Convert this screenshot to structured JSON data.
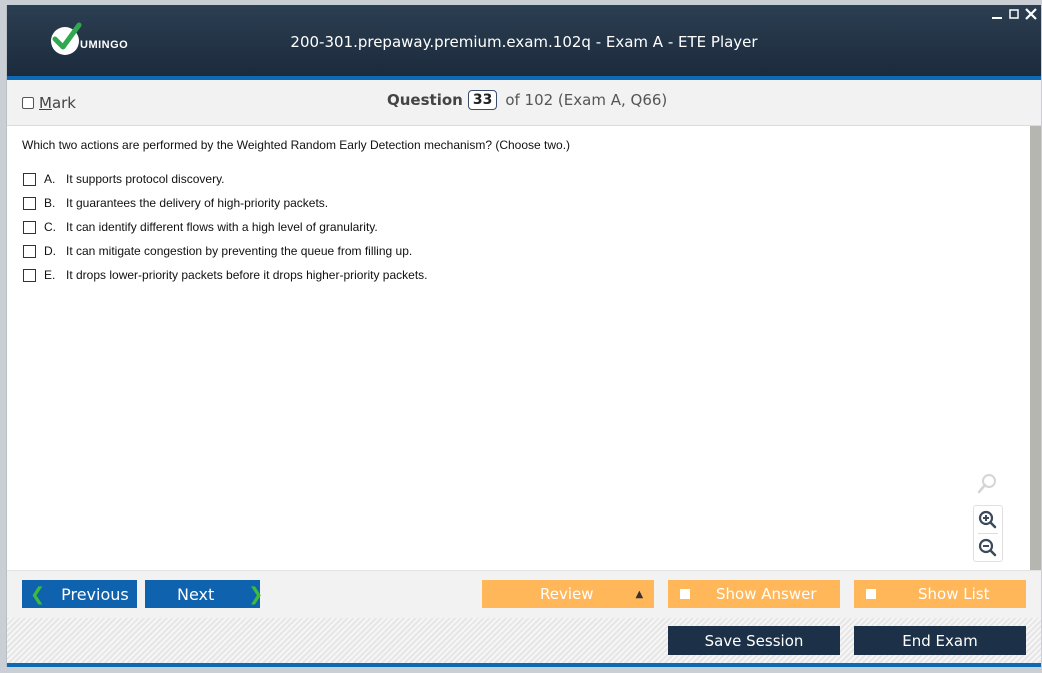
{
  "window": {
    "title": "200-301.prepaway.premium.exam.102q - Exam A - ETE Player",
    "logo_text": "UMINGO",
    "controls": [
      {
        "name": "minimize",
        "icon": "minimize-icon"
      },
      {
        "name": "maximize",
        "icon": "maximize-icon"
      },
      {
        "name": "close",
        "icon": "close-icon"
      }
    ]
  },
  "question_bar": {
    "mark_label_underlined": "M",
    "mark_label_rest": "ark",
    "question_label": "Question",
    "current_number": "33",
    "of_text": "of 102 (Exam A, Q66)"
  },
  "question": {
    "text": "Which two actions are performed by the Weighted Random Early Detection mechanism? (Choose two.)",
    "options": [
      {
        "letter": "A.",
        "text": "It supports protocol discovery.",
        "checked": false
      },
      {
        "letter": "B.",
        "text": "It guarantees the delivery of high-priority packets.",
        "checked": false
      },
      {
        "letter": "C.",
        "text": "It can identify different flows with a high level of granularity.",
        "checked": false
      },
      {
        "letter": "D.",
        "text": "It can mitigate congestion by preventing the queue from filling up.",
        "checked": false
      },
      {
        "letter": "E.",
        "text": "It drops lower-priority packets before it drops higher-priority packets.",
        "checked": false
      }
    ]
  },
  "zoom_tools": [
    "search-icon",
    "zoom-in-icon",
    "zoom-out-icon"
  ],
  "nav": {
    "previous_label": "Previous",
    "next_label": "Next",
    "review_label": "Review",
    "show_answer_label": "Show Answer",
    "show_list_label": "Show List"
  },
  "footer": {
    "save_session_label": "Save Session",
    "end_exam_label": "End Exam"
  },
  "colors": {
    "titlebar": "#1b2b3c",
    "accent_blue": "#0e62ae",
    "orange": "#ffb75a",
    "dark_button": "#1c3148",
    "chevron_green": "#3dbb3d"
  }
}
